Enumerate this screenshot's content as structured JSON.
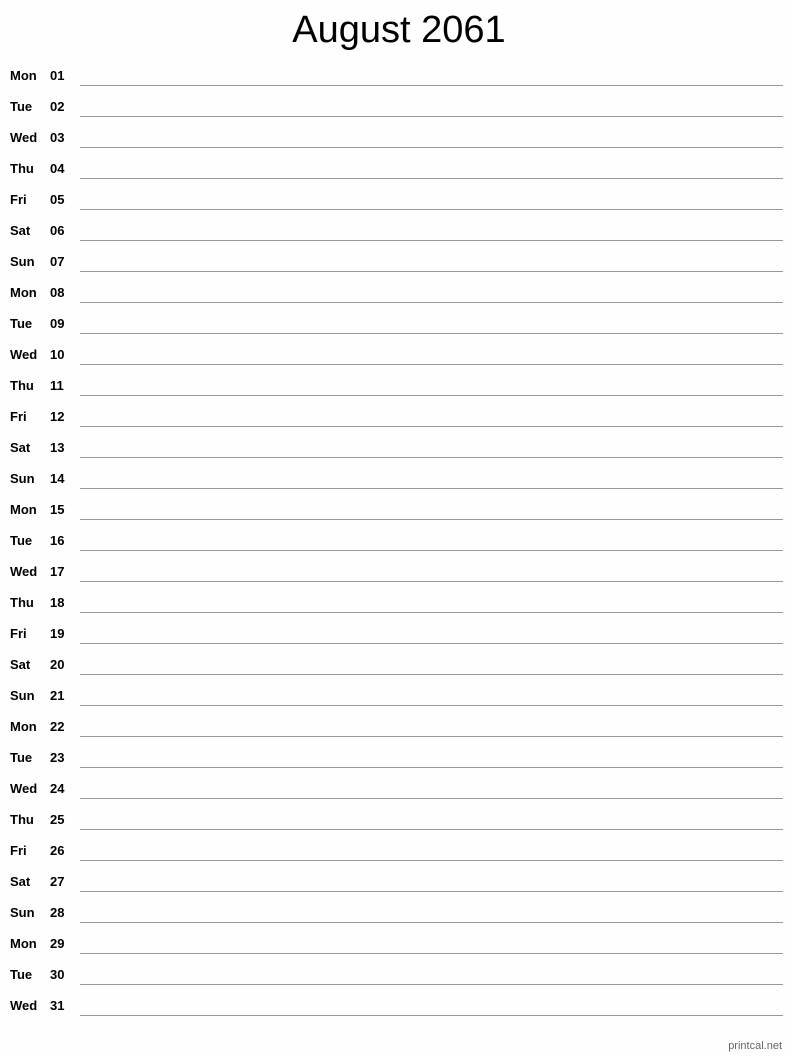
{
  "title": "August 2061",
  "days": [
    {
      "dow": "Mon",
      "day": "01"
    },
    {
      "dow": "Tue",
      "day": "02"
    },
    {
      "dow": "Wed",
      "day": "03"
    },
    {
      "dow": "Thu",
      "day": "04"
    },
    {
      "dow": "Fri",
      "day": "05"
    },
    {
      "dow": "Sat",
      "day": "06"
    },
    {
      "dow": "Sun",
      "day": "07"
    },
    {
      "dow": "Mon",
      "day": "08"
    },
    {
      "dow": "Tue",
      "day": "09"
    },
    {
      "dow": "Wed",
      "day": "10"
    },
    {
      "dow": "Thu",
      "day": "11"
    },
    {
      "dow": "Fri",
      "day": "12"
    },
    {
      "dow": "Sat",
      "day": "13"
    },
    {
      "dow": "Sun",
      "day": "14"
    },
    {
      "dow": "Mon",
      "day": "15"
    },
    {
      "dow": "Tue",
      "day": "16"
    },
    {
      "dow": "Wed",
      "day": "17"
    },
    {
      "dow": "Thu",
      "day": "18"
    },
    {
      "dow": "Fri",
      "day": "19"
    },
    {
      "dow": "Sat",
      "day": "20"
    },
    {
      "dow": "Sun",
      "day": "21"
    },
    {
      "dow": "Mon",
      "day": "22"
    },
    {
      "dow": "Tue",
      "day": "23"
    },
    {
      "dow": "Wed",
      "day": "24"
    },
    {
      "dow": "Thu",
      "day": "25"
    },
    {
      "dow": "Fri",
      "day": "26"
    },
    {
      "dow": "Sat",
      "day": "27"
    },
    {
      "dow": "Sun",
      "day": "28"
    },
    {
      "dow": "Mon",
      "day": "29"
    },
    {
      "dow": "Tue",
      "day": "30"
    },
    {
      "dow": "Wed",
      "day": "31"
    }
  ],
  "footer": "printcal.net"
}
